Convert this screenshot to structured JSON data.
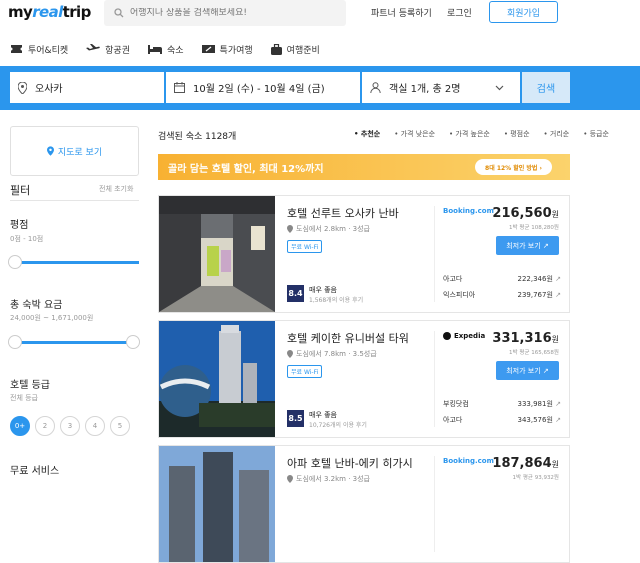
{
  "header": {
    "logo_a": "my",
    "logo_b": "real",
    "logo_c": "trip",
    "search_placeholder": "어행지나 상품을 검색해보세요!",
    "partner": "파트너 등록하기",
    "login": "로그인",
    "signup": "회원가입"
  },
  "nav": [
    {
      "label": "투어&티켓",
      "icon": "ticket-icon"
    },
    {
      "label": "항공권",
      "icon": "airplane-icon"
    },
    {
      "label": "숙소",
      "icon": "bed-icon"
    },
    {
      "label": "특가여행",
      "icon": "coupon-icon"
    },
    {
      "label": "여행준비",
      "icon": "luggage-icon"
    }
  ],
  "searchbar": {
    "location": "오사카",
    "dates": "10월 2일 (수) - 10월 4일 (금)",
    "guests": "객실 1개, 총 2명",
    "button": "검색"
  },
  "sidebar": {
    "map_button": "지도로 보기",
    "filter_title": "필터",
    "reset": "전체 초기화",
    "rating_title": "평점",
    "rating_range": "0점 - 10점",
    "price_title": "총 숙박 요금",
    "price_range": "24,000원 ~ 1,671,000원",
    "grade_title": "호텔 등급",
    "grade_sub": "전체 등급",
    "stars": [
      "0+",
      "2",
      "3",
      "4",
      "5"
    ],
    "free_title": "무료 서비스"
  },
  "results": {
    "count": "검색된 숙소 1128개",
    "sorts": [
      "추천순",
      "가격 낮은순",
      "가격 높은순",
      "평점순",
      "거리순",
      "등급순"
    ],
    "banner": "골라 담는 호텔 할인, 최대 12%까지",
    "banner_button": "8대 12% 할인 방법 ›"
  },
  "hotels": [
    {
      "name": "호텔 선루트 오사카 난바",
      "location": "도심에서 2.8km · 3성급",
      "wifi": "무료 Wi-Fi",
      "score": "8.4",
      "rating_text": "매우 좋음",
      "reviews": "1,568개의 이용 후기",
      "provider": "Booking.com",
      "price": "216,560",
      "unit": "원",
      "per_night": "1박 평균 108,280원",
      "deal": "최저가 보기",
      "others": [
        {
          "name": "아고다",
          "price": "222,346원"
        },
        {
          "name": "익스피디아",
          "price": "239,767원"
        }
      ]
    },
    {
      "name": "호텔 케이한 유니버설 타워",
      "location": "도심에서 7.8km · 3.5성급",
      "wifi": "무료 Wi-Fi",
      "score": "8.5",
      "rating_text": "매우 좋음",
      "reviews": "10,726개의 이용 후기",
      "provider": "Expedia",
      "price": "331,316",
      "unit": "원",
      "per_night": "1박 평균 165,658원",
      "deal": "최저가 보기",
      "others": [
        {
          "name": "부킹닷컴",
          "price": "333,981원"
        },
        {
          "name": "아고다",
          "price": "343,576원"
        }
      ]
    },
    {
      "name": "아파 호텔 난바-에키 히가시",
      "location": "도심에서 3.2km · 3성급",
      "provider": "Booking.com",
      "price": "187,864",
      "unit": "원",
      "per_night": "1박 평균 93,932원"
    }
  ],
  "colors": {
    "brand": "#2b96ed",
    "banner": "#f8b132",
    "score": "#233067"
  }
}
